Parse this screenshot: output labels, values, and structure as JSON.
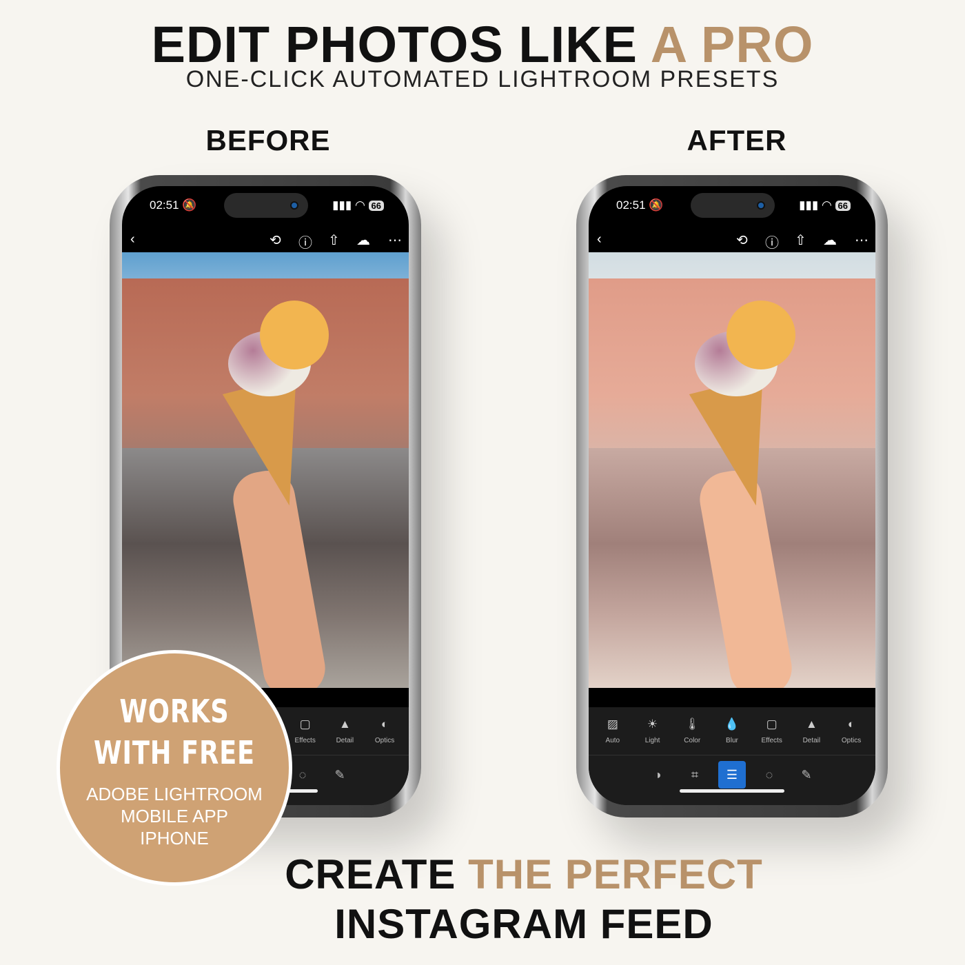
{
  "header": {
    "title_main": "EDIT PHOTOS LIKE ",
    "title_accent": "A PRO",
    "subtitle": "ONE-CLICK AUTOMATED LIGHTROOM PRESETS"
  },
  "labels": {
    "before": "BEFORE",
    "after": "AFTER"
  },
  "phone": {
    "time": "02:51",
    "battery": "66",
    "tools": [
      {
        "label": "Auto",
        "icon": "auto-icon"
      },
      {
        "label": "Light",
        "icon": "sun-icon"
      },
      {
        "label": "Color",
        "icon": "thermometer-icon"
      },
      {
        "label": "Blur",
        "icon": "drop-icon"
      },
      {
        "label": "Effects",
        "icon": "vignette-icon"
      },
      {
        "label": "Detail",
        "icon": "triangle-icon"
      },
      {
        "label": "Optics",
        "icon": "lens-icon"
      }
    ]
  },
  "badge": {
    "line1": "WORKS",
    "line2": "WITH FREE",
    "line3": "ADOBE LIGHTROOM",
    "line4": "MOBILE APP",
    "line5": "IPHONE"
  },
  "footer": {
    "line1_a": "CREATE ",
    "line1_b": "THE PERFECT",
    "line2": "INSTAGRAM FEED"
  },
  "colors": {
    "accent": "#b8926a",
    "badge": "#cfa274",
    "active_tool": "#1f6fd1",
    "background": "#f7f5f0"
  }
}
